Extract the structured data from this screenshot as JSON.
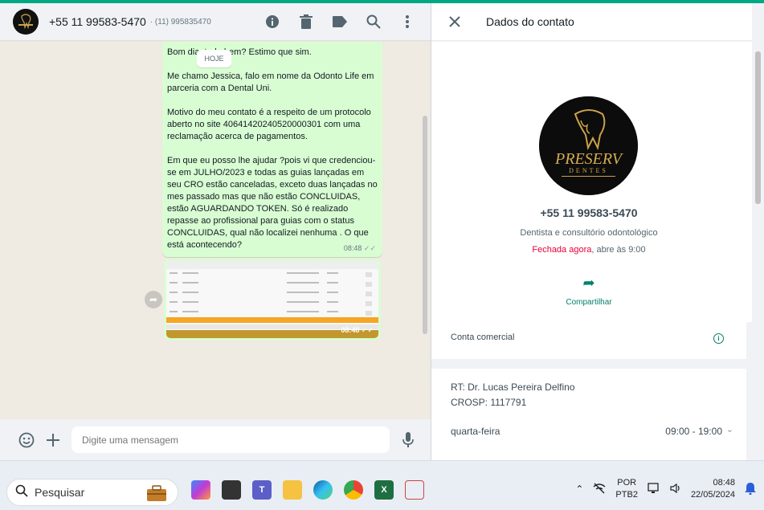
{
  "chat_header": {
    "contact_name": "+55 11 99583-5470",
    "contact_sub": "· (11) 995835470"
  },
  "chat": {
    "today_label": "HOJE",
    "message": {
      "paragraphs": [
        "Bom dia, tudo bem? Estimo que sim.",
        "Me chamo Jessica, falo em nome da Odonto Life em parceria com a Dental Uni.",
        "Motivo do meu contato é a respeito de um protocolo aberto no site 40641420240520000301 com uma reclamação acerca de pagamentos.",
        "Em que eu posso lhe ajudar ?pois vi que credenciou-se em JULHO/2023 e todas as guias lançadas em seu CRO estão canceladas, exceto duas lançadas no mes passado mas que não estão CONCLUIDAS, estão AGUARDANDO TOKEN. Só é realizado repasse ao profissional para guias com o status CONCLUIDAS, qual não localizei nenhuma . O que está acontecendo?"
      ],
      "time": "08:48"
    },
    "image_message": {
      "time": "08:48"
    }
  },
  "composer": {
    "placeholder": "Digite uma mensagem"
  },
  "contact_panel": {
    "title": "Dados do contato",
    "phone": "+55 11 99583-5470",
    "description": "Dentista e consultório odontológico",
    "status_closed": "Fechada agora",
    "status_rest": ", abre às 9:00",
    "share_label": "Compartilhar",
    "business_label": "Conta comercial",
    "rt_line1": "RT: Dr. Lucas Pereira Delfino",
    "rt_line2": "CROSP: 1117791",
    "day": "quarta-feira",
    "hours": "09:00 - 19:00",
    "logo_text": "PRESERV",
    "logo_sub": "DENTES"
  },
  "taskbar": {
    "search_label": "Pesquisar",
    "lang_top": "POR",
    "lang_bottom": "PTB2",
    "time": "08:48",
    "date": "22/05/2024"
  },
  "colors": {
    "accent": "#00a884",
    "bubble": "#d9fdd3",
    "closed": "#ea0038"
  }
}
